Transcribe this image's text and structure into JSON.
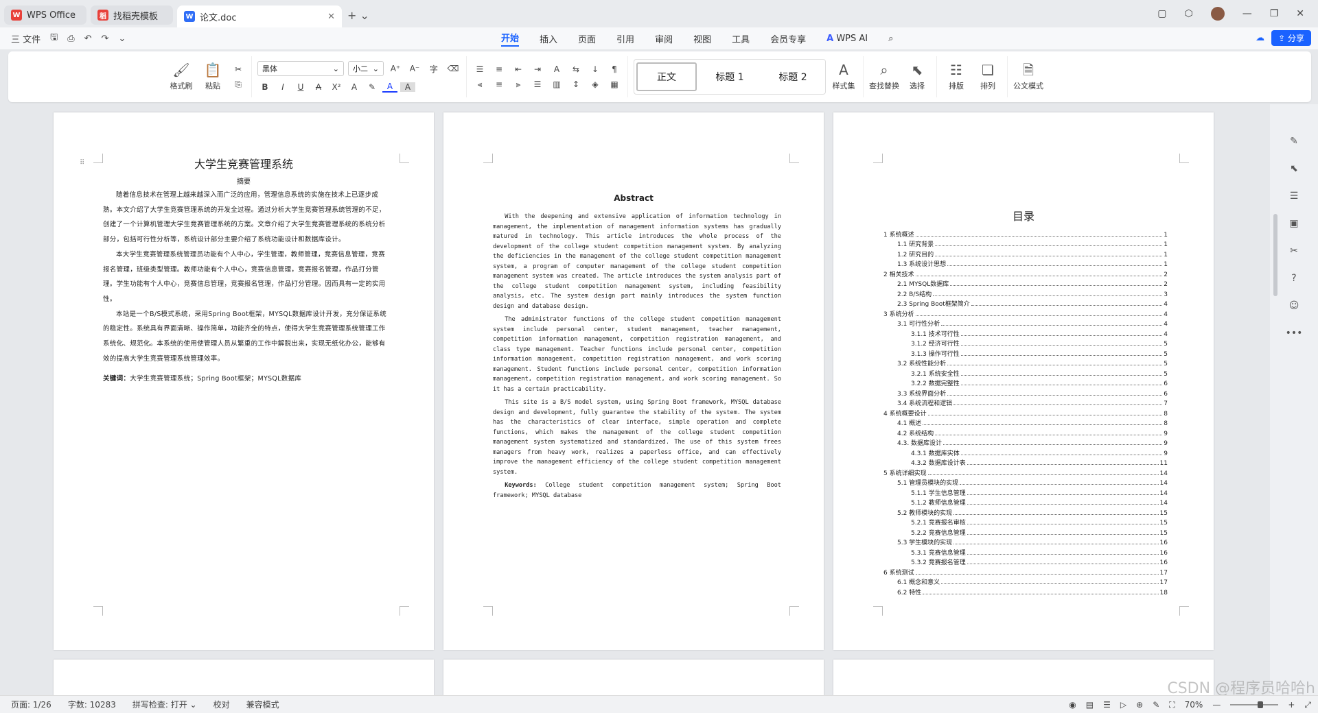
{
  "tabs": [
    {
      "label": "WPS Office",
      "icon": "W",
      "color": "#e8403a"
    },
    {
      "label": "找稻壳模板",
      "icon": "稻",
      "color": "#e8403a"
    },
    {
      "label": "论文.doc",
      "icon": "W",
      "color": "#2f6df6"
    }
  ],
  "menu": {
    "file": "三 文件",
    "tabs": [
      "开始",
      "插入",
      "页面",
      "引用",
      "审阅",
      "视图",
      "工具",
      "会员专享"
    ],
    "wps_ai": "WPS AI",
    "share": "分享"
  },
  "ribbon": {
    "format_painter": "格式刷",
    "paste": "粘贴",
    "font": "黑体",
    "size": "小二",
    "styles": [
      "正文",
      "标题 1",
      "标题 2"
    ],
    "style_set": "样式集",
    "find_replace": "查找替换",
    "select": "选择",
    "layout": "排版",
    "arrange": "排列",
    "doc_format": "公文模式"
  },
  "page1": {
    "title": "大学生竞赛管理系统",
    "subtitle": "摘要",
    "paragraphs": [
      "随着信息技术在管理上越来越深入而广泛的应用，管理信息系统的实施在技术上已逐步成熟。本文介绍了大学生竞赛管理系统的开发全过程。通过分析大学生竞赛管理系统管理的不足，创建了一个计算机管理大学生竞赛管理系统的方案。文章介绍了大学生竞赛管理系统的系统分析部分，包括可行性分析等，系统设计部分主要介绍了系统功能设计和数据库设计。",
      "本大学生竞赛管理系统管理员功能有个人中心，学生管理，教师管理，竞赛信息管理，竞赛报名管理，班级类型管理。教师功能有个人中心，竞赛信息管理，竞赛报名管理，作品打分管理。学生功能有个人中心，竞赛信息管理，竞赛报名管理，作品打分管理。因而具有一定的实用性。",
      "本站是一个B/S模式系统，采用Spring Boot框架，MYSQL数据库设计开发，充分保证系统的稳定性。系统具有界面清晰、操作简单，功能齐全的特点，使得大学生竞赛管理系统管理工作系统化、规范化。本系统的使用使管理人员从繁重的工作中解脱出来，实现无纸化办公，能够有效的提高大学生竞赛管理系统管理效率。"
    ],
    "keywords_label": "关键词：",
    "keywords": "大学生竞赛管理系统；Spring Boot框架；MYSQL数据库"
  },
  "page2": {
    "title": "Abstract",
    "paragraphs": [
      "With the deepening and extensive application of information technology in management, the implementation of management information systems has gradually matured in technology. This article introduces the whole process of the development of the college student competition management system. By analyzing the deficiencies in the management of the college student competition management system, a program of computer management of the college student competition management system was created. The article introduces the system analysis part of the college student competition management system, including feasibility analysis, etc. The system design part mainly introduces the system function design and database design.",
      "The administrator functions of the college student competition management system include personal center, student management, teacher management, competition information management, competition registration management, and class type management. Teacher functions include personal center, competition information management, competition registration management, and work scoring management. Student functions include personal center, competition information management, competition registration management, and work scoring management. So it has a certain practicability.",
      "This site is a B/S model system, using Spring Boot framework, MYSQL database design and development, fully guarantee the stability of the system. The system has the characteristics of clear interface, simple operation and complete functions, which makes the management of the college student competition management system systematized and standardized. The use of this system frees managers from heavy work, realizes a paperless office, and can effectively improve the management efficiency of the college student competition management system."
    ],
    "keywords_label": "Keywords:",
    "keywords": "College student competition management system; Spring Boot framework; MYSQL database"
  },
  "page3": {
    "title": "目录",
    "toc": [
      {
        "t": "1 系统概述",
        "p": "1",
        "l": 0
      },
      {
        "t": "1.1 研究背景",
        "p": "1",
        "l": 1
      },
      {
        "t": "1.2 研究目的",
        "p": "1",
        "l": 1
      },
      {
        "t": "1.3 系统设计思想",
        "p": "1",
        "l": 1
      },
      {
        "t": "2 相关技术",
        "p": "2",
        "l": 0
      },
      {
        "t": "2.1 MYSQL数据库",
        "p": "2",
        "l": 1
      },
      {
        "t": "2.2 B/S结构",
        "p": "3",
        "l": 1
      },
      {
        "t": "2.3 Spring Boot框架简介",
        "p": "4",
        "l": 1
      },
      {
        "t": "3 系统分析",
        "p": "4",
        "l": 0
      },
      {
        "t": "3.1 可行性分析",
        "p": "4",
        "l": 1
      },
      {
        "t": "3.1.1 技术可行性",
        "p": "4",
        "l": 2
      },
      {
        "t": "3.1.2 经济可行性",
        "p": "5",
        "l": 2
      },
      {
        "t": "3.1.3 操作可行性",
        "p": "5",
        "l": 2
      },
      {
        "t": "3.2 系统性能分析",
        "p": "5",
        "l": 1
      },
      {
        "t": "3.2.1 系统安全性",
        "p": "5",
        "l": 2
      },
      {
        "t": "3.2.2 数据完整性",
        "p": "6",
        "l": 2
      },
      {
        "t": "3.3 系统界面分析",
        "p": "6",
        "l": 1
      },
      {
        "t": "3.4 系统流程和逻辑",
        "p": "7",
        "l": 1
      },
      {
        "t": "4 系统概要设计",
        "p": "8",
        "l": 0
      },
      {
        "t": "4.1 概述",
        "p": "8",
        "l": 1
      },
      {
        "t": "4.2 系统结构",
        "p": "9",
        "l": 1
      },
      {
        "t": "4.3. 数据库设计",
        "p": "9",
        "l": 1
      },
      {
        "t": "4.3.1 数据库实体",
        "p": "9",
        "l": 2
      },
      {
        "t": "4.3.2 数据库设计表",
        "p": "11",
        "l": 2
      },
      {
        "t": "5 系统详细实现",
        "p": "14",
        "l": 0
      },
      {
        "t": "5.1 管理员模块的实现",
        "p": "14",
        "l": 1
      },
      {
        "t": "5.1.1 学生信息管理",
        "p": "14",
        "l": 2
      },
      {
        "t": "5.1.2 教师信息管理",
        "p": "14",
        "l": 2
      },
      {
        "t": "5.2 教师模块的实现",
        "p": "15",
        "l": 1
      },
      {
        "t": "5.2.1 竞赛报名审核",
        "p": "15",
        "l": 2
      },
      {
        "t": "5.2.2 竞赛信息管理",
        "p": "15",
        "l": 2
      },
      {
        "t": "5.3 学生模块的实现",
        "p": "16",
        "l": 1
      },
      {
        "t": "5.3.1 竞赛信息管理",
        "p": "16",
        "l": 2
      },
      {
        "t": "5.3.2 竞赛报名管理",
        "p": "16",
        "l": 2
      },
      {
        "t": "6 系统测试",
        "p": "17",
        "l": 0
      },
      {
        "t": "6.1 概念和意义",
        "p": "17",
        "l": 1
      },
      {
        "t": "6.2 特性",
        "p": "18",
        "l": 1
      }
    ]
  },
  "status": {
    "page": "页面: 1/26",
    "words": "字数: 10283",
    "spell": "拼写检查: 打开",
    "proof": "校对",
    "compat": "兼容模式",
    "zoom": "70%"
  },
  "watermark": "CSDN @程序员哈哈h"
}
